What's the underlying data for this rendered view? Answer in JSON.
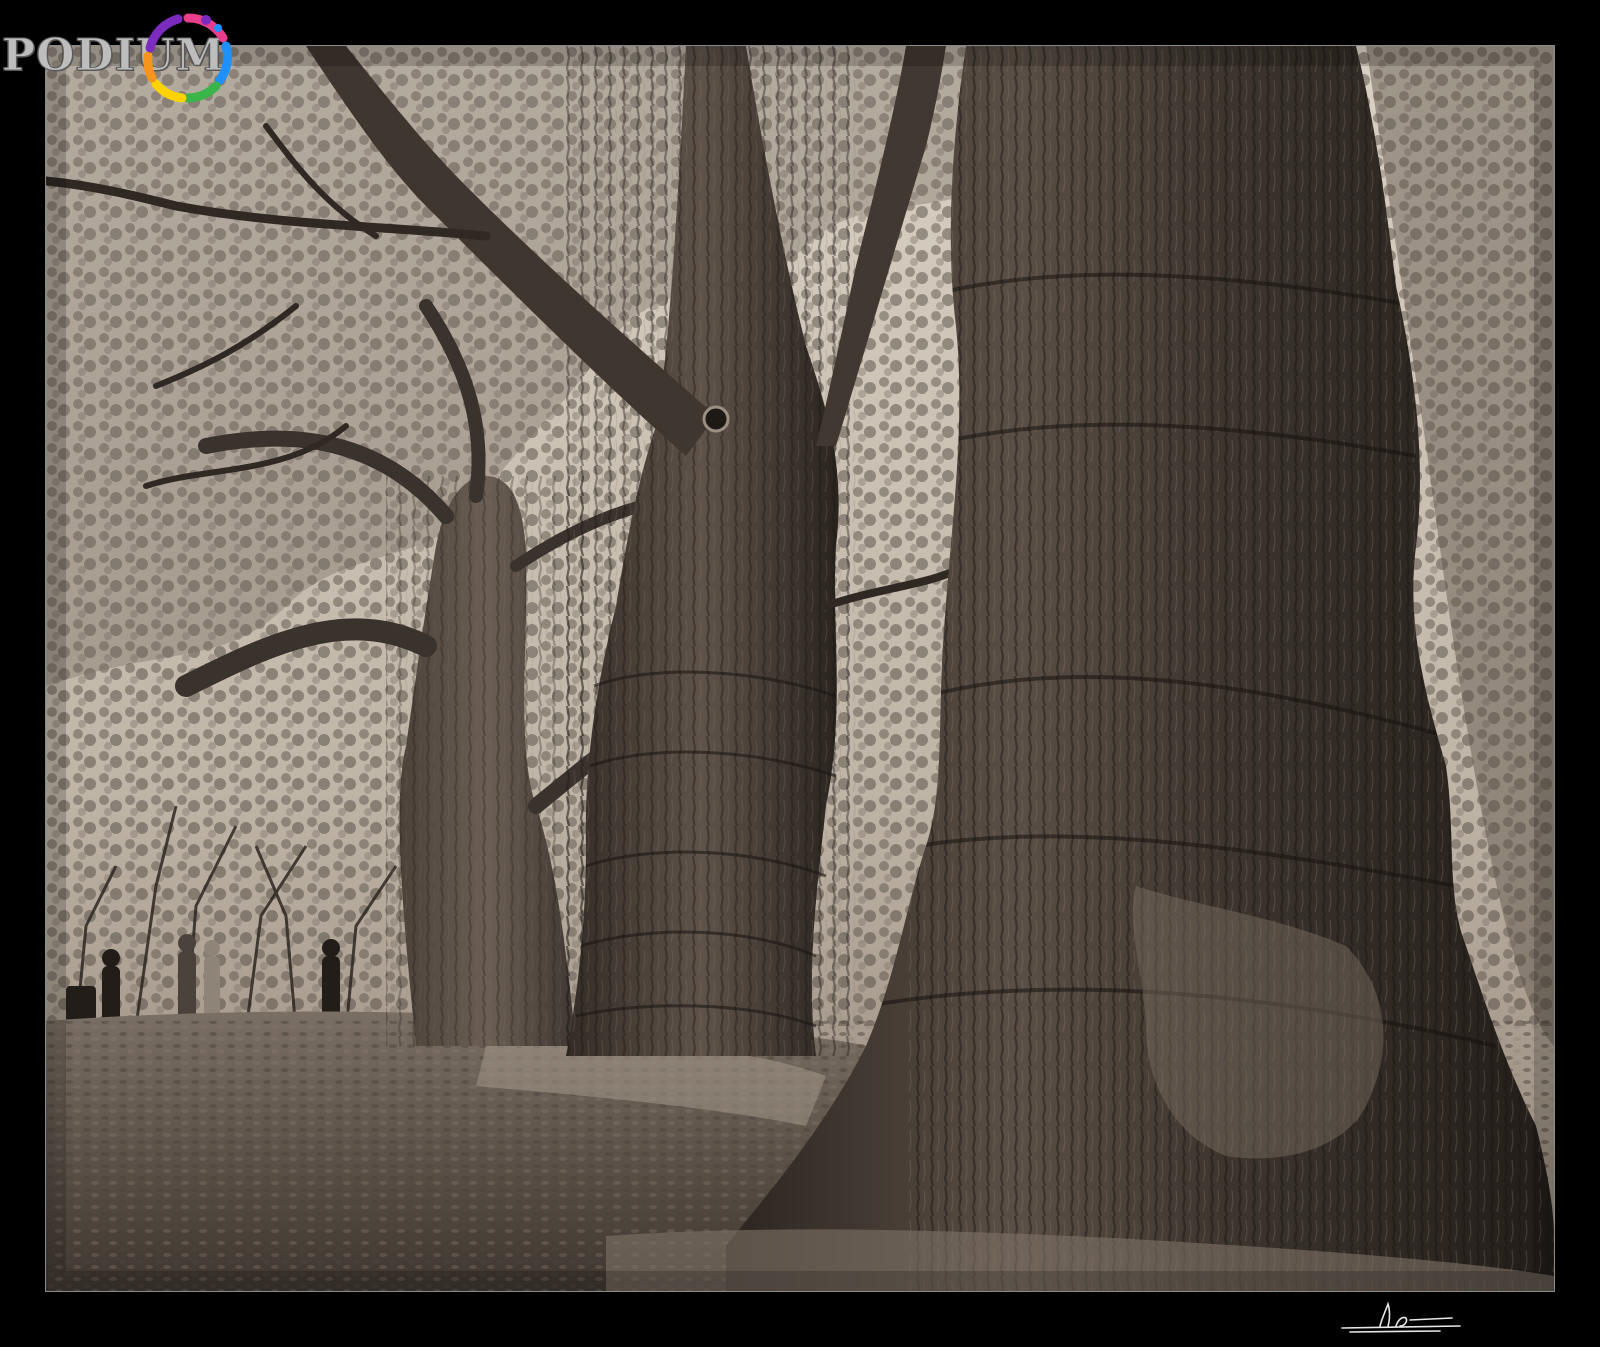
{
  "image": {
    "alt": "",
    "palette": {
      "frame": "#000000",
      "sepia_dark": "#2a2420",
      "sepia_mid": "#6e6258",
      "sepia_light": "#c9c0b3",
      "sky": "#ddd6cb"
    }
  },
  "logo": {
    "text": "PODIUM",
    "icon": "colorful-ring-icon",
    "colors": [
      "#e83e8c",
      "#f7941d",
      "#ffd200",
      "#39b54a",
      "#1e90ff",
      "#7b2cbf"
    ]
  },
  "signature": {
    "icon": "signature-mark"
  }
}
